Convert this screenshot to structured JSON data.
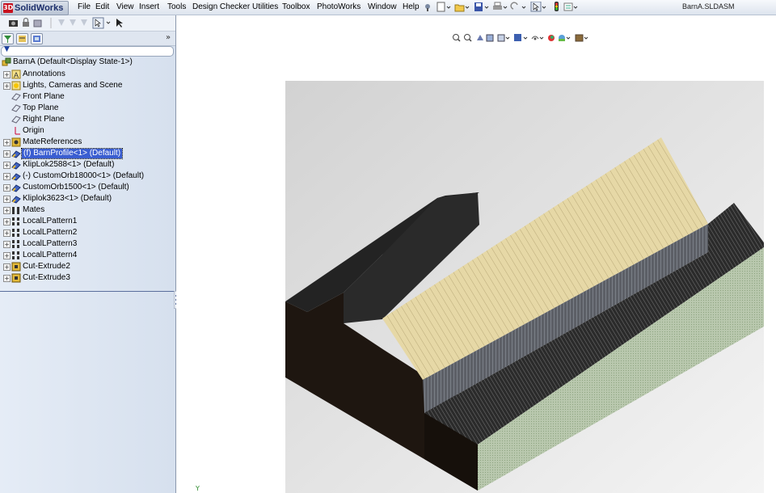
{
  "app": {
    "brand": "SolidWorks",
    "window_title": "BarnA.SLDASM"
  },
  "menu": {
    "items": [
      "File",
      "Edit",
      "View",
      "Insert",
      "Tools",
      "Design Checker",
      "Utilities",
      "Toolbox",
      "PhotoWorks",
      "Window",
      "Help"
    ]
  },
  "feature_tree": {
    "root": "BarnA  (Default<Display State-1>)",
    "items": [
      {
        "label": "Annotations",
        "icon": "annotations-icon",
        "expandable": true
      },
      {
        "label": "Lights, Cameras and Scene",
        "icon": "lights-cameras-icon",
        "expandable": true
      },
      {
        "label": "Front Plane",
        "icon": "plane-icon",
        "expandable": false
      },
      {
        "label": "Top Plane",
        "icon": "plane-icon",
        "expandable": false
      },
      {
        "label": "Right Plane",
        "icon": "plane-icon",
        "expandable": false
      },
      {
        "label": "Origin",
        "icon": "origin-icon",
        "expandable": false
      },
      {
        "label": "MateReferences",
        "icon": "mate-references-icon",
        "expandable": true
      },
      {
        "label": "(f) BarnProfile<1> (Default)",
        "icon": "part-icon",
        "expandable": true,
        "selected": true
      },
      {
        "label": "KlipLok2588<1> (Default)",
        "icon": "part-icon",
        "expandable": true
      },
      {
        "label": "(-) CustomOrb18000<1> (Default)",
        "icon": "part-icon",
        "expandable": true
      },
      {
        "label": "CustomOrb1500<1> (Default)",
        "icon": "part-icon",
        "expandable": true
      },
      {
        "label": "Kliplok3623<1> (Default)",
        "icon": "part-icon",
        "expandable": true
      },
      {
        "label": "Mates",
        "icon": "mates-icon",
        "expandable": true
      },
      {
        "label": "LocalLPattern1",
        "icon": "pattern-icon",
        "expandable": true
      },
      {
        "label": "LocalLPattern2",
        "icon": "pattern-icon",
        "expandable": true
      },
      {
        "label": "LocalLPattern3",
        "icon": "pattern-icon",
        "expandable": true
      },
      {
        "label": "LocalLPattern4",
        "icon": "pattern-icon",
        "expandable": true
      },
      {
        "label": "Cut-Extrude2",
        "icon": "cut-extrude-icon",
        "expandable": true
      },
      {
        "label": "Cut-Extrude3",
        "icon": "cut-extrude-icon",
        "expandable": true
      }
    ]
  },
  "colors": {
    "selection": "#3a5ed1",
    "panel": "#dfe6f0",
    "roof_light": "#e6d8a6",
    "wall_dark": "#1e1610",
    "siding_green": "#b9c8ae",
    "roof_dark": "#2a2a2a"
  }
}
